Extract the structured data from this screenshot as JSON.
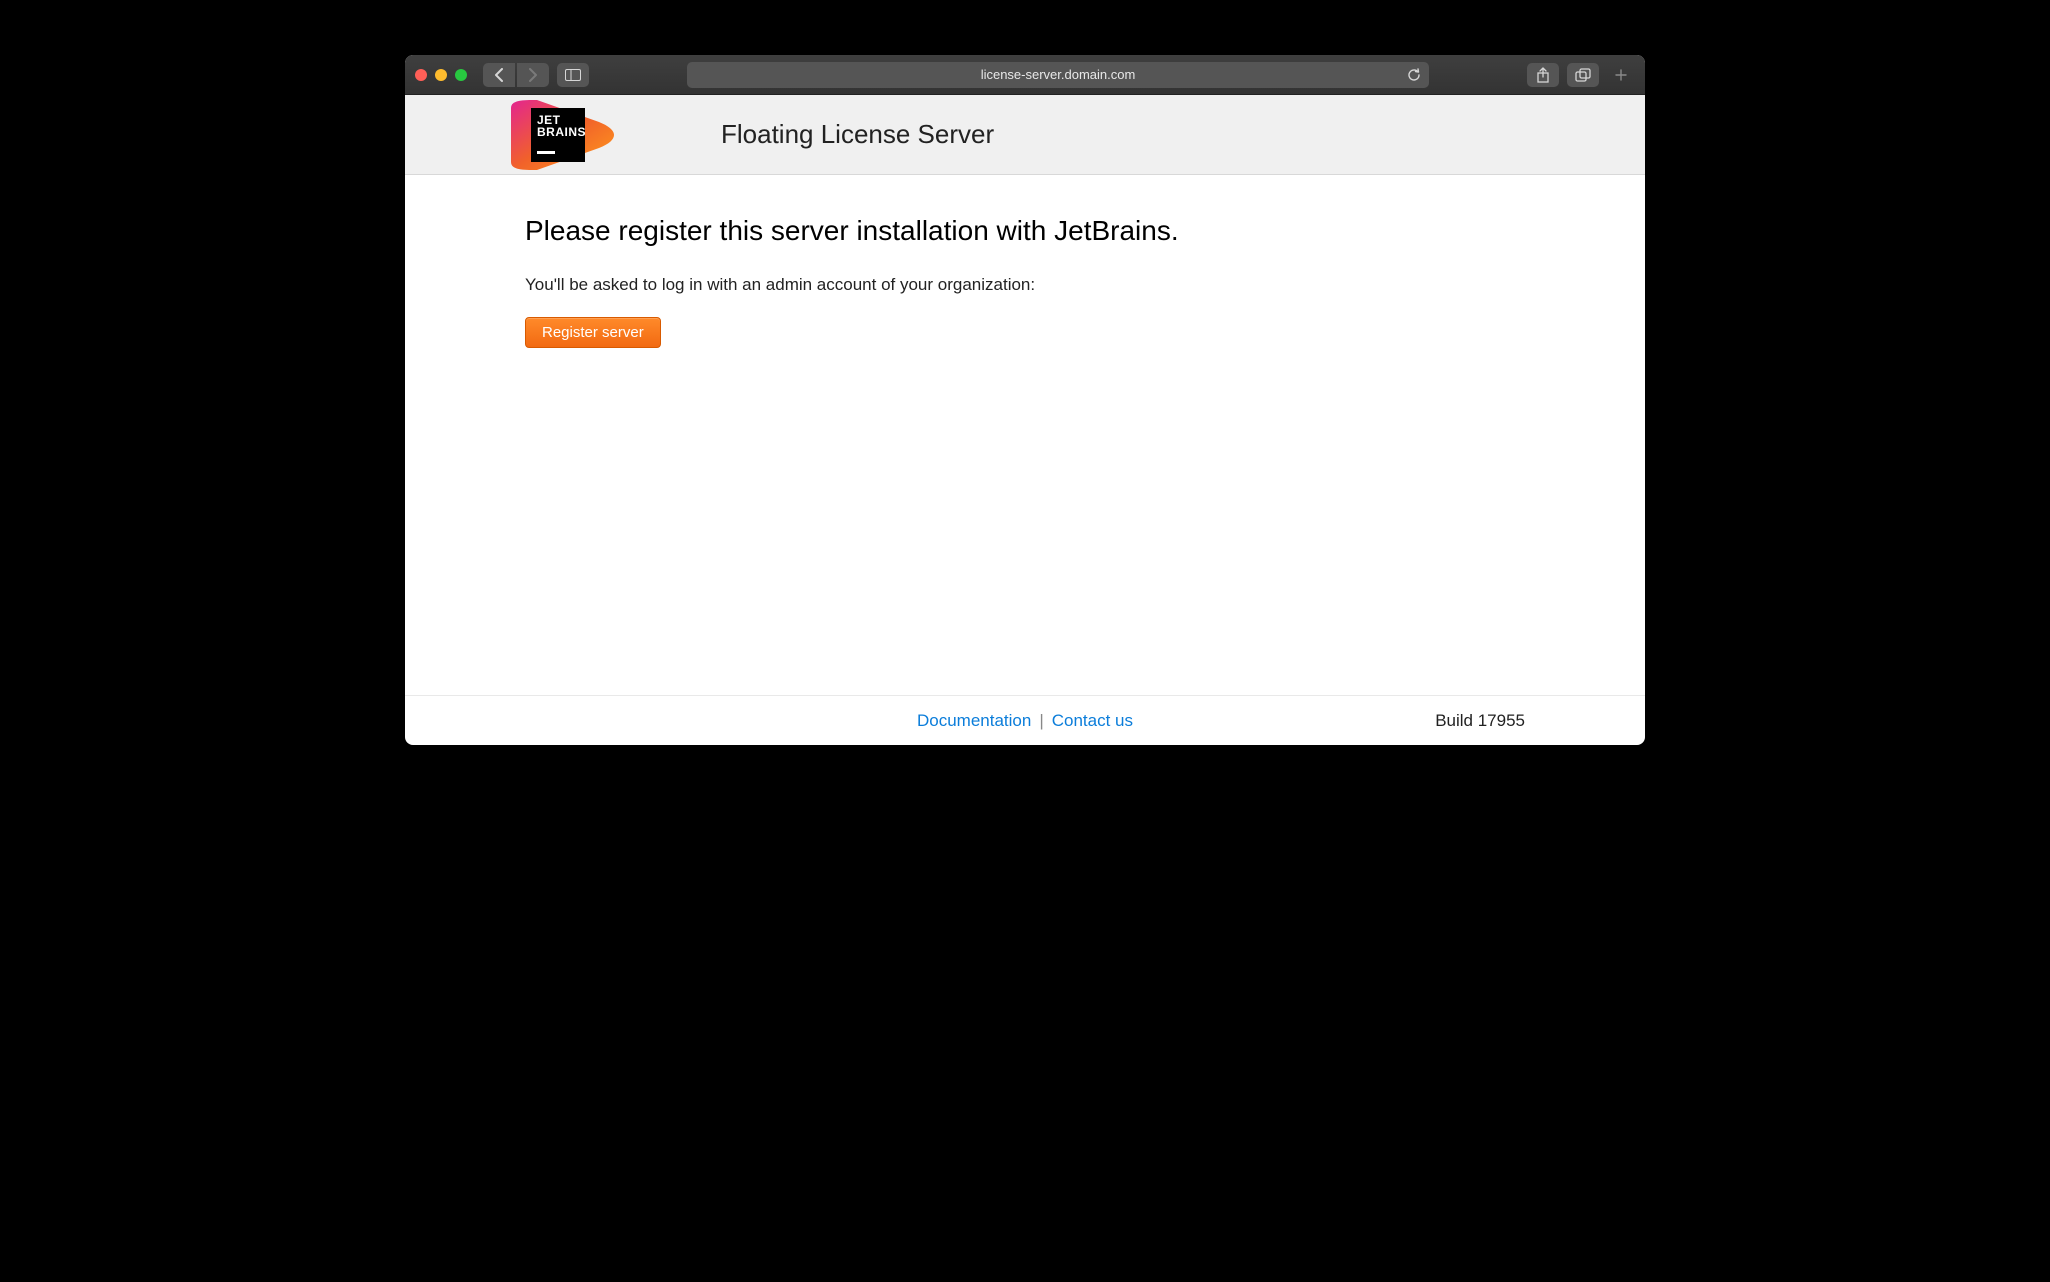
{
  "browser": {
    "url": "license-server.domain.com"
  },
  "header": {
    "logo_text_line1": "JET",
    "logo_text_line2": "BRAINS",
    "title": "Floating License Server"
  },
  "main": {
    "heading": "Please register this server installation with JetBrains.",
    "subheading": "You'll be asked to log in with an admin account of your organization:",
    "register_button": "Register server"
  },
  "footer": {
    "documentation_label": "Documentation",
    "separator": "|",
    "contact_label": "Contact us",
    "build_label": "Build 17955"
  }
}
